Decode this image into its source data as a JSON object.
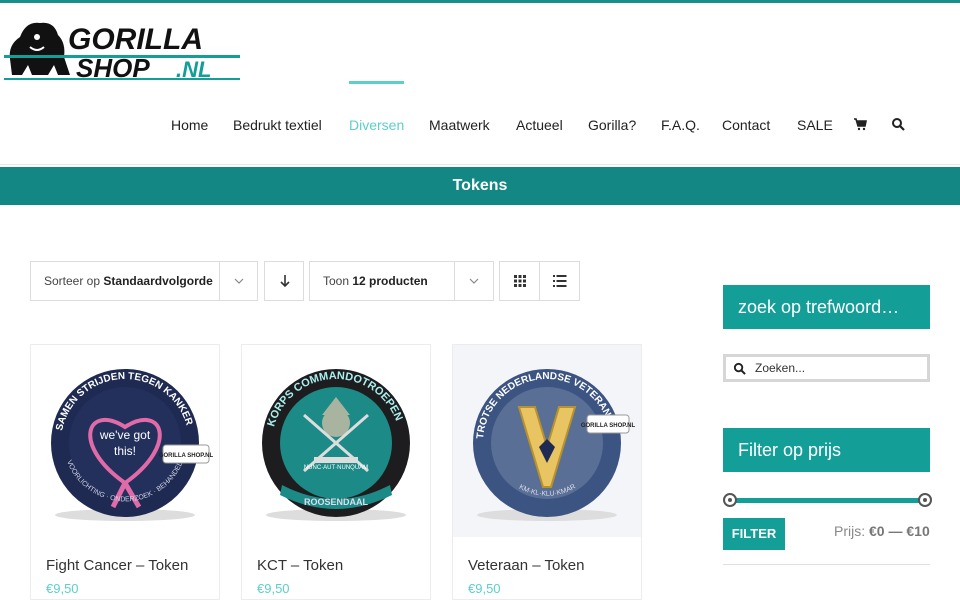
{
  "colors": {
    "accent": "#5ccfc9",
    "title_bar": "#138783",
    "widget": "#139e98"
  },
  "logo": {
    "line1": "GORILLA",
    "line2": "SHOP",
    "tld": ".NL",
    "mascot_icon": "gorilla-icon"
  },
  "nav": {
    "items": [
      "Home",
      "Bedrukt textiel",
      "Diversen",
      "Maatwerk",
      "Actueel",
      "Gorilla?",
      "F.A.Q.",
      "Contact",
      "SALE"
    ],
    "active": "Diversen",
    "cart_icon": "cart-icon",
    "search_icon": "search-icon"
  },
  "page_title": "Tokens",
  "sort": {
    "prefix": "Sorteer op",
    "value": "Standaardvolgorde",
    "direction_icon": "arrow-down-icon"
  },
  "show": {
    "prefix": "Toon",
    "value": "12 producten"
  },
  "view": {
    "grid_icon": "grid-icon",
    "list_icon": "list-icon"
  },
  "products": [
    {
      "name": "Fight Cancer – Token",
      "price": "€9,50",
      "img_top": "SAMEN STRIJDEN TEGEN KANKER",
      "img_center_1": "we've got",
      "img_center_2": "this!",
      "img_bottom": "VOORLICHTING · ONDERZOEK · BEHANDELING",
      "badge": "GORILLA SHOP.NL"
    },
    {
      "name": "KCT – Token",
      "price": "€9,50",
      "img_top": "KORPS COMMANDOTROEPEN",
      "img_motto": "NUNC·AUT·NUNQUAM",
      "img_bottom": "ROOSENDAAL"
    },
    {
      "name": "Veteraan – Token",
      "price": "€9,50",
      "img_top": "TROTSE NEDERLANDSE VETERANEN",
      "img_bottom": "KM·KL·KLU·KMAR",
      "badge": "GORILLA SHOP.NL"
    }
  ],
  "sidebar": {
    "search_title": "zoek op trefwoord…",
    "search_placeholder": "Zoeken...",
    "filter_title": "Filter op prijs",
    "filter_button": "FILTER",
    "price_label": "Prijs:",
    "price_min": "€0",
    "price_dash": "—",
    "price_max": "€10",
    "slider_min_fraction": 0,
    "slider_max_fraction": 1
  }
}
